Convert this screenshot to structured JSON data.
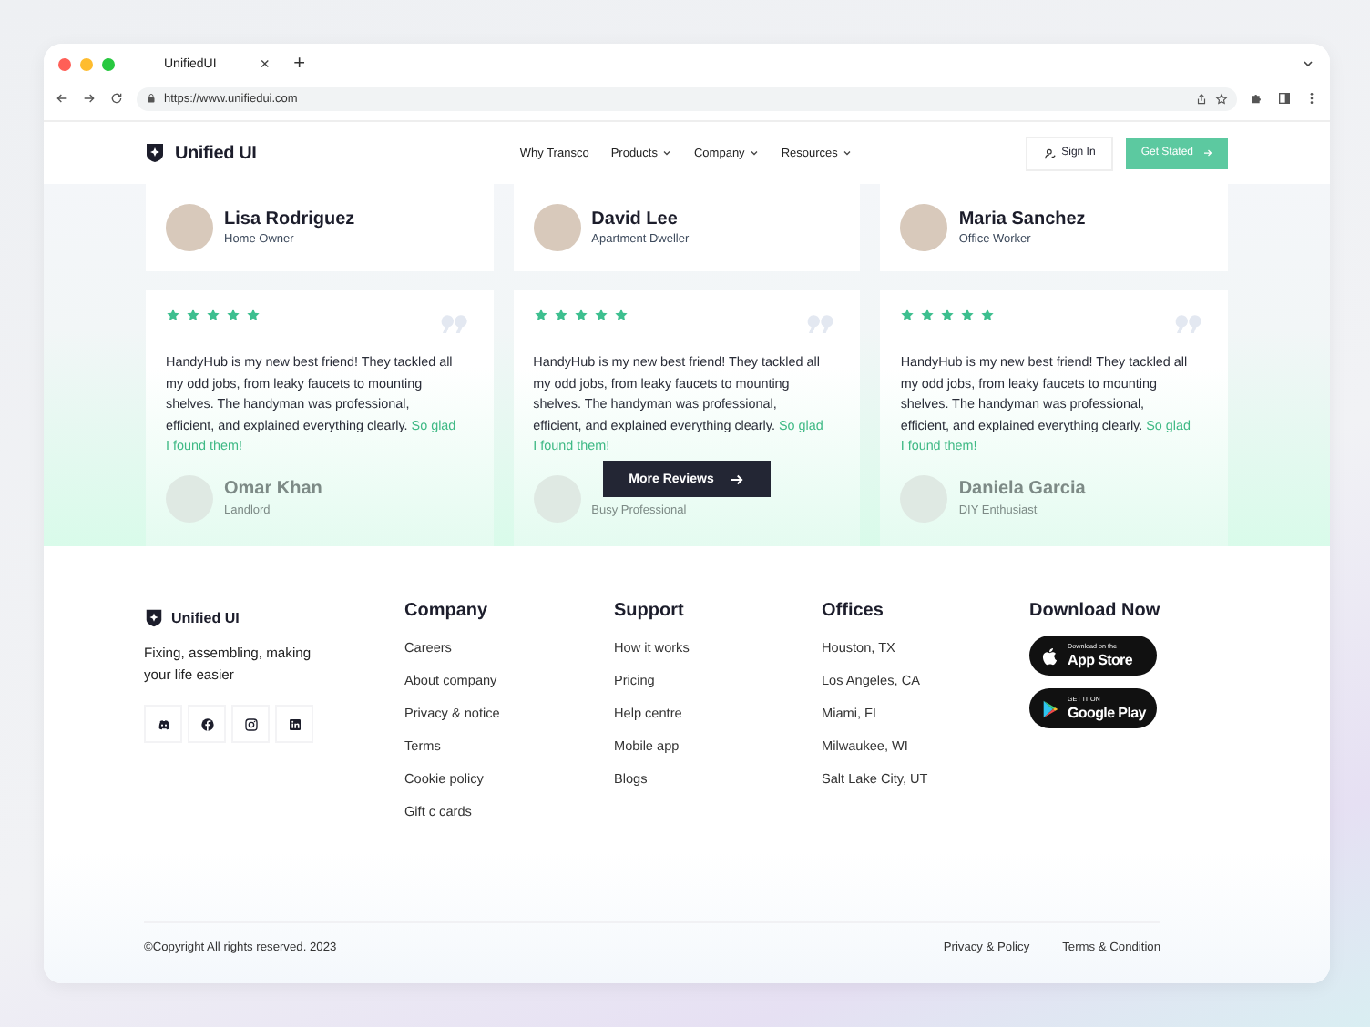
{
  "browser": {
    "tab_title": "UnifiedUI",
    "tab_close": "×",
    "new_tab": "+",
    "url": "https://www.unifiedui.com"
  },
  "nav": {
    "logo": "Unified UI",
    "links": [
      {
        "label": "Why Transco",
        "dropdown": false
      },
      {
        "label": "Products",
        "dropdown": true
      },
      {
        "label": "Company",
        "dropdown": true
      },
      {
        "label": "Resources",
        "dropdown": true
      }
    ],
    "sign_in": "Sign In",
    "cta": "Get Stated"
  },
  "reviewers": [
    {
      "name": "Lisa Rodriguez",
      "role": "Home Owner"
    },
    {
      "name": "David Lee",
      "role": "Apartment Dweller"
    },
    {
      "name": "Maria Sanchez",
      "role": "Office Worker"
    }
  ],
  "reviews": [
    {
      "stars": 5,
      "text": "HandyHub is my new best friend!  They tackled all my odd jobs, from leaky faucets to mounting shelves.  The handyman was professional, efficient, and explained everything clearly.",
      "highlight": "So glad I found them!",
      "next_reviewer": {
        "name": "Omar Khan",
        "role": "Landlord"
      }
    },
    {
      "stars": 5,
      "text": "HandyHub is my new best friend!  They tackled all my odd jobs, from leaky faucets to mounting shelves.  The handyman was professional, efficient, and explained everything clearly.",
      "highlight": "So glad I found them!",
      "next_reviewer": {
        "role": "Busy Professional"
      }
    },
    {
      "stars": 5,
      "text": "HandyHub is my new best friend!  They tackled all my odd jobs, from leaky faucets to mounting shelves.  The handyman was professional, efficient, and explained everything clearly.",
      "highlight": "So glad I found them!",
      "next_reviewer": {
        "name": "Daniela Garcia",
        "role": "DIY Enthusiast"
      }
    }
  ],
  "more_reviews": "More Reviews",
  "footer": {
    "logo": "Unified UI",
    "tagline": "Fixing, assembling, making your life easier",
    "columns": [
      {
        "title": "Company",
        "links": [
          "Careers",
          "About company",
          "Privacy & notice",
          "Terms",
          "Cookie policy",
          "Gift c cards"
        ]
      },
      {
        "title": "Support",
        "links": [
          "How it works",
          "Pricing",
          "Help centre",
          "Mobile app",
          "Blogs"
        ]
      },
      {
        "title": "Offices",
        "links": [
          "Houston, TX",
          "Los Angeles, CA",
          "Miami, FL",
          "Milwaukee, WI",
          "Salt Lake City, UT"
        ]
      }
    ],
    "download": {
      "title": "Download Now",
      "badges": [
        {
          "kind": "apple",
          "small": "Download on the",
          "big": "App Store"
        },
        {
          "kind": "google",
          "small": "GET IT ON",
          "big": "Google Play"
        }
      ]
    },
    "copyright": "©Copyright All rights reserved. 2023",
    "legal_links": [
      "Privacy & Policy",
      "Terms & Condition"
    ]
  }
}
